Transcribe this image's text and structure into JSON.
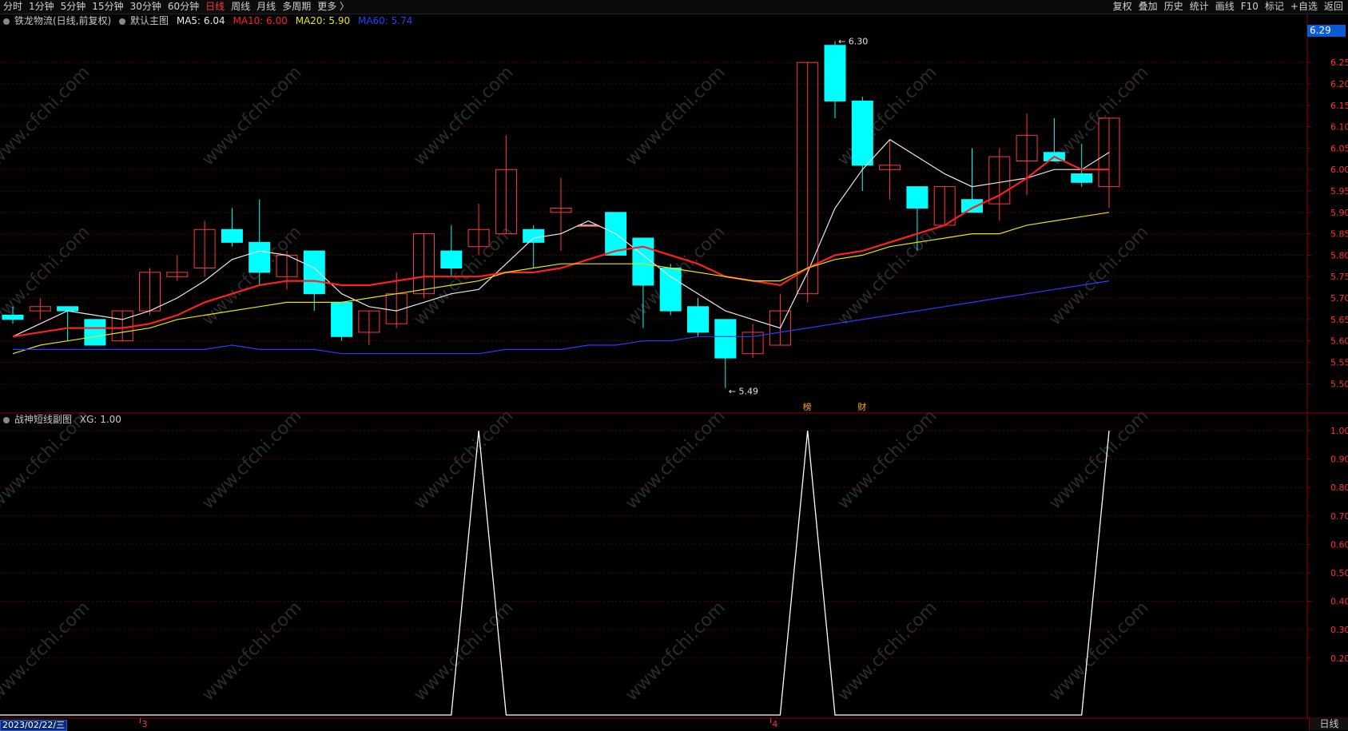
{
  "toolbar": {
    "left_items": [
      {
        "label": "分时",
        "active": false
      },
      {
        "label": "1分钟",
        "active": false
      },
      {
        "label": "5分钟",
        "active": false
      },
      {
        "label": "15分钟",
        "active": false
      },
      {
        "label": "30分钟",
        "active": false
      },
      {
        "label": "60分钟",
        "active": false
      },
      {
        "label": "日线",
        "active": true
      },
      {
        "label": "周线",
        "active": false
      },
      {
        "label": "月线",
        "active": false
      },
      {
        "label": "多周期",
        "active": false
      },
      {
        "label": "更多 〉",
        "active": false
      }
    ],
    "right_items": [
      "复权",
      "叠加",
      "历史",
      "统计",
      "画线",
      "F10",
      "标记",
      "+自选",
      "返回"
    ]
  },
  "main_header": {
    "stock": "铁龙物流(日线,前复权)",
    "template": "默认主图",
    "ma5": "MA5: 6.04",
    "ma10": "MA10: 6.00",
    "ma20": "MA20: 5.90",
    "ma60": "MA60: 5.74"
  },
  "sub_header": {
    "name": "战神短线副图",
    "value": "XG: 1.00"
  },
  "price_tag": "6.29",
  "bottom": {
    "date": "2023/02/22/三",
    "period": "日线",
    "month_marks": [
      {
        "label": "3",
        "index": 5
      },
      {
        "label": "4",
        "index": 28
      }
    ]
  },
  "watermark": "www.cfchi.com",
  "colors": {
    "up": "#ff3a3a",
    "down": "#00ffff",
    "ma5": "#e8e8e8",
    "ma10": "#ff2020",
    "ma20": "#e6e600",
    "ma60": "#2a3cff",
    "xg": "#ffffff",
    "grid": "#5a0000"
  },
  "chart_data": [
    {
      "type": "candlestick",
      "title": "铁龙物流(日线,前复权)",
      "y_ticks": [
        "6.25",
        "6.20",
        "6.15",
        "6.10",
        "6.05",
        "6.00",
        "5.95",
        "5.90",
        "5.85",
        "5.80",
        "5.75",
        "5.70",
        "5.65",
        "5.60",
        "5.55",
        "5.50"
      ],
      "ylim": [
        5.48,
        6.31
      ],
      "ohlc": [
        [
          5.66,
          5.68,
          5.64,
          5.65
        ],
        [
          5.67,
          5.7,
          5.65,
          5.68
        ],
        [
          5.68,
          5.68,
          5.6,
          5.67
        ],
        [
          5.65,
          5.65,
          5.59,
          5.59
        ],
        [
          5.6,
          5.67,
          5.6,
          5.67
        ],
        [
          5.67,
          5.77,
          5.66,
          5.76
        ],
        [
          5.75,
          5.8,
          5.74,
          5.76
        ],
        [
          5.77,
          5.88,
          5.75,
          5.86
        ],
        [
          5.86,
          5.91,
          5.82,
          5.83
        ],
        [
          5.83,
          5.93,
          5.73,
          5.76
        ],
        [
          5.75,
          5.81,
          5.72,
          5.8
        ],
        [
          5.81,
          5.81,
          5.67,
          5.71
        ],
        [
          5.69,
          5.69,
          5.6,
          5.61
        ],
        [
          5.62,
          5.67,
          5.59,
          5.67
        ],
        [
          5.64,
          5.76,
          5.63,
          5.71
        ],
        [
          5.71,
          5.85,
          5.7,
          5.85
        ],
        [
          5.81,
          5.87,
          5.75,
          5.77
        ],
        [
          5.82,
          5.92,
          5.8,
          5.86
        ],
        [
          5.85,
          6.08,
          5.85,
          6.0
        ],
        [
          5.86,
          5.87,
          5.77,
          5.83
        ],
        [
          5.9,
          5.98,
          5.81,
          5.91
        ],
        [
          5.87,
          5.87,
          5.87,
          5.87
        ],
        [
          5.9,
          5.9,
          5.8,
          5.8
        ],
        [
          5.84,
          5.84,
          5.63,
          5.73
        ],
        [
          5.77,
          5.78,
          5.66,
          5.67
        ],
        [
          5.68,
          5.7,
          5.61,
          5.62
        ],
        [
          5.65,
          5.65,
          5.49,
          5.56
        ],
        [
          5.57,
          5.64,
          5.56,
          5.62
        ],
        [
          5.59,
          5.71,
          5.59,
          5.67
        ],
        [
          5.71,
          6.25,
          5.69,
          6.25
        ],
        [
          6.29,
          6.3,
          6.12,
          6.16
        ],
        [
          6.16,
          6.17,
          5.95,
          6.01
        ],
        [
          6.0,
          6.07,
          5.93,
          6.01
        ],
        [
          5.96,
          5.96,
          5.81,
          5.91
        ],
        [
          5.87,
          5.96,
          5.87,
          5.96
        ],
        [
          5.93,
          6.05,
          5.9,
          5.9
        ],
        [
          5.92,
          6.05,
          5.88,
          6.03
        ],
        [
          6.02,
          6.13,
          5.94,
          6.08
        ],
        [
          6.04,
          6.12,
          6.02,
          6.02
        ],
        [
          5.99,
          6.06,
          5.96,
          5.97
        ],
        [
          5.96,
          6.12,
          5.91,
          6.12
        ]
      ],
      "annotations": [
        {
          "text": "6.30",
          "index": 30,
          "value": 6.3
        },
        {
          "text": "5.49",
          "index": 26,
          "value": 5.49
        }
      ],
      "event_marks": [
        {
          "text": "榜",
          "index": 29
        },
        {
          "text": "财",
          "index": 31
        }
      ],
      "series": [
        {
          "name": "MA5",
          "values": [
            5.61,
            5.64,
            5.67,
            5.66,
            5.65,
            5.67,
            5.7,
            5.74,
            5.79,
            5.81,
            5.8,
            5.77,
            5.71,
            5.68,
            5.67,
            5.69,
            5.71,
            5.72,
            5.78,
            5.84,
            5.85,
            5.88,
            5.85,
            5.8,
            5.75,
            5.71,
            5.67,
            5.65,
            5.63,
            5.76,
            5.91,
            6.0,
            6.07,
            6.03,
            5.99,
            5.96,
            5.97,
            5.98,
            6.0,
            6.0,
            6.04
          ]
        },
        {
          "name": "MA10",
          "values": [
            5.61,
            5.62,
            5.63,
            5.63,
            5.63,
            5.64,
            5.66,
            5.69,
            5.71,
            5.73,
            5.74,
            5.74,
            5.73,
            5.73,
            5.74,
            5.75,
            5.75,
            5.75,
            5.76,
            5.76,
            5.77,
            5.79,
            5.81,
            5.82,
            5.8,
            5.78,
            5.75,
            5.74,
            5.73,
            5.77,
            5.8,
            5.81,
            5.83,
            5.85,
            5.87,
            5.91,
            5.94,
            5.98,
            6.03,
            6.0,
            6.0
          ]
        },
        {
          "name": "MA20",
          "values": [
            5.57,
            5.59,
            5.6,
            5.61,
            5.62,
            5.63,
            5.65,
            5.66,
            5.67,
            5.68,
            5.69,
            5.69,
            5.69,
            5.7,
            5.71,
            5.72,
            5.73,
            5.74,
            5.76,
            5.77,
            5.78,
            5.78,
            5.78,
            5.78,
            5.77,
            5.76,
            5.75,
            5.74,
            5.74,
            5.77,
            5.79,
            5.8,
            5.82,
            5.83,
            5.84,
            5.85,
            5.85,
            5.87,
            5.88,
            5.89,
            5.9
          ]
        },
        {
          "name": "MA60",
          "values": [
            5.58,
            5.58,
            5.58,
            5.58,
            5.58,
            5.58,
            5.58,
            5.58,
            5.59,
            5.58,
            5.58,
            5.58,
            5.57,
            5.57,
            5.57,
            5.57,
            5.57,
            5.57,
            5.58,
            5.58,
            5.58,
            5.59,
            5.59,
            5.6,
            5.6,
            5.61,
            5.61,
            5.61,
            5.62,
            5.63,
            5.64,
            5.65,
            5.66,
            5.67,
            5.68,
            5.69,
            5.7,
            5.71,
            5.72,
            5.73,
            5.74
          ]
        }
      ]
    },
    {
      "type": "line",
      "title": "战神短线副图",
      "y_ticks": [
        "1.00",
        "0.90",
        "0.80",
        "0.70",
        "0.60",
        "0.50",
        "0.40",
        "0.30",
        "0.20"
      ],
      "ylim": [
        0,
        1
      ],
      "series": [
        {
          "name": "XG",
          "values": [
            0,
            0,
            0,
            0,
            0,
            0,
            0,
            0,
            0,
            0,
            0,
            0,
            0,
            0,
            0,
            0,
            0,
            1,
            0,
            0,
            0,
            0,
            0,
            0,
            0,
            0,
            0,
            0,
            0,
            1,
            0,
            0,
            0,
            0,
            0,
            0,
            0,
            0,
            0,
            0,
            1
          ]
        }
      ]
    }
  ]
}
